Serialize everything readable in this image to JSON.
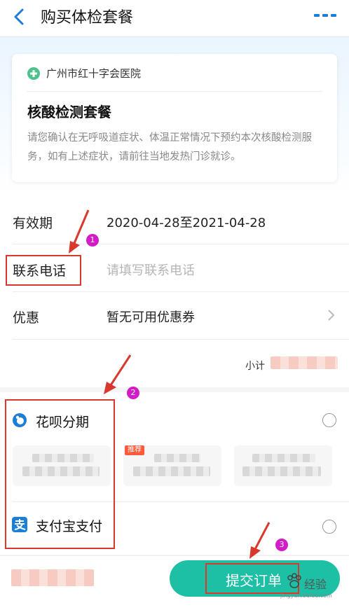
{
  "header": {
    "title": "购买体检套餐"
  },
  "card": {
    "hospital": "广州市红十字会医院",
    "package_title": "核酸检测套餐",
    "description": "请您确认在无呼吸道症状、体温正常情况下预约本次核酸检测服务，如有上述症状，请前往当地发热门诊就诊。"
  },
  "info": {
    "validity_label": "有效期",
    "validity_value": "2020-04-28至2021-04-28",
    "phone_label": "联系电话",
    "phone_placeholder": "请填写联系电话",
    "discount_label": "优惠",
    "discount_value": "暂无可用优惠券",
    "subtotal_label": "小计"
  },
  "payment": {
    "huabei_label": "花呗分期",
    "recommend_tag": "推荐",
    "alipay_label": "支付宝支付"
  },
  "footer": {
    "submit_label": "提交订单"
  },
  "annotations": {
    "step1": "1",
    "step2": "2",
    "step3": "3"
  },
  "watermark": {
    "text": "经验",
    "sub": "jingyan.baidu.com"
  },
  "colors": {
    "accent": "#1dbfa5",
    "annotation_red": "#d9382c",
    "step_badge": "#d21cc8",
    "link_blue": "#1b7ed8"
  }
}
